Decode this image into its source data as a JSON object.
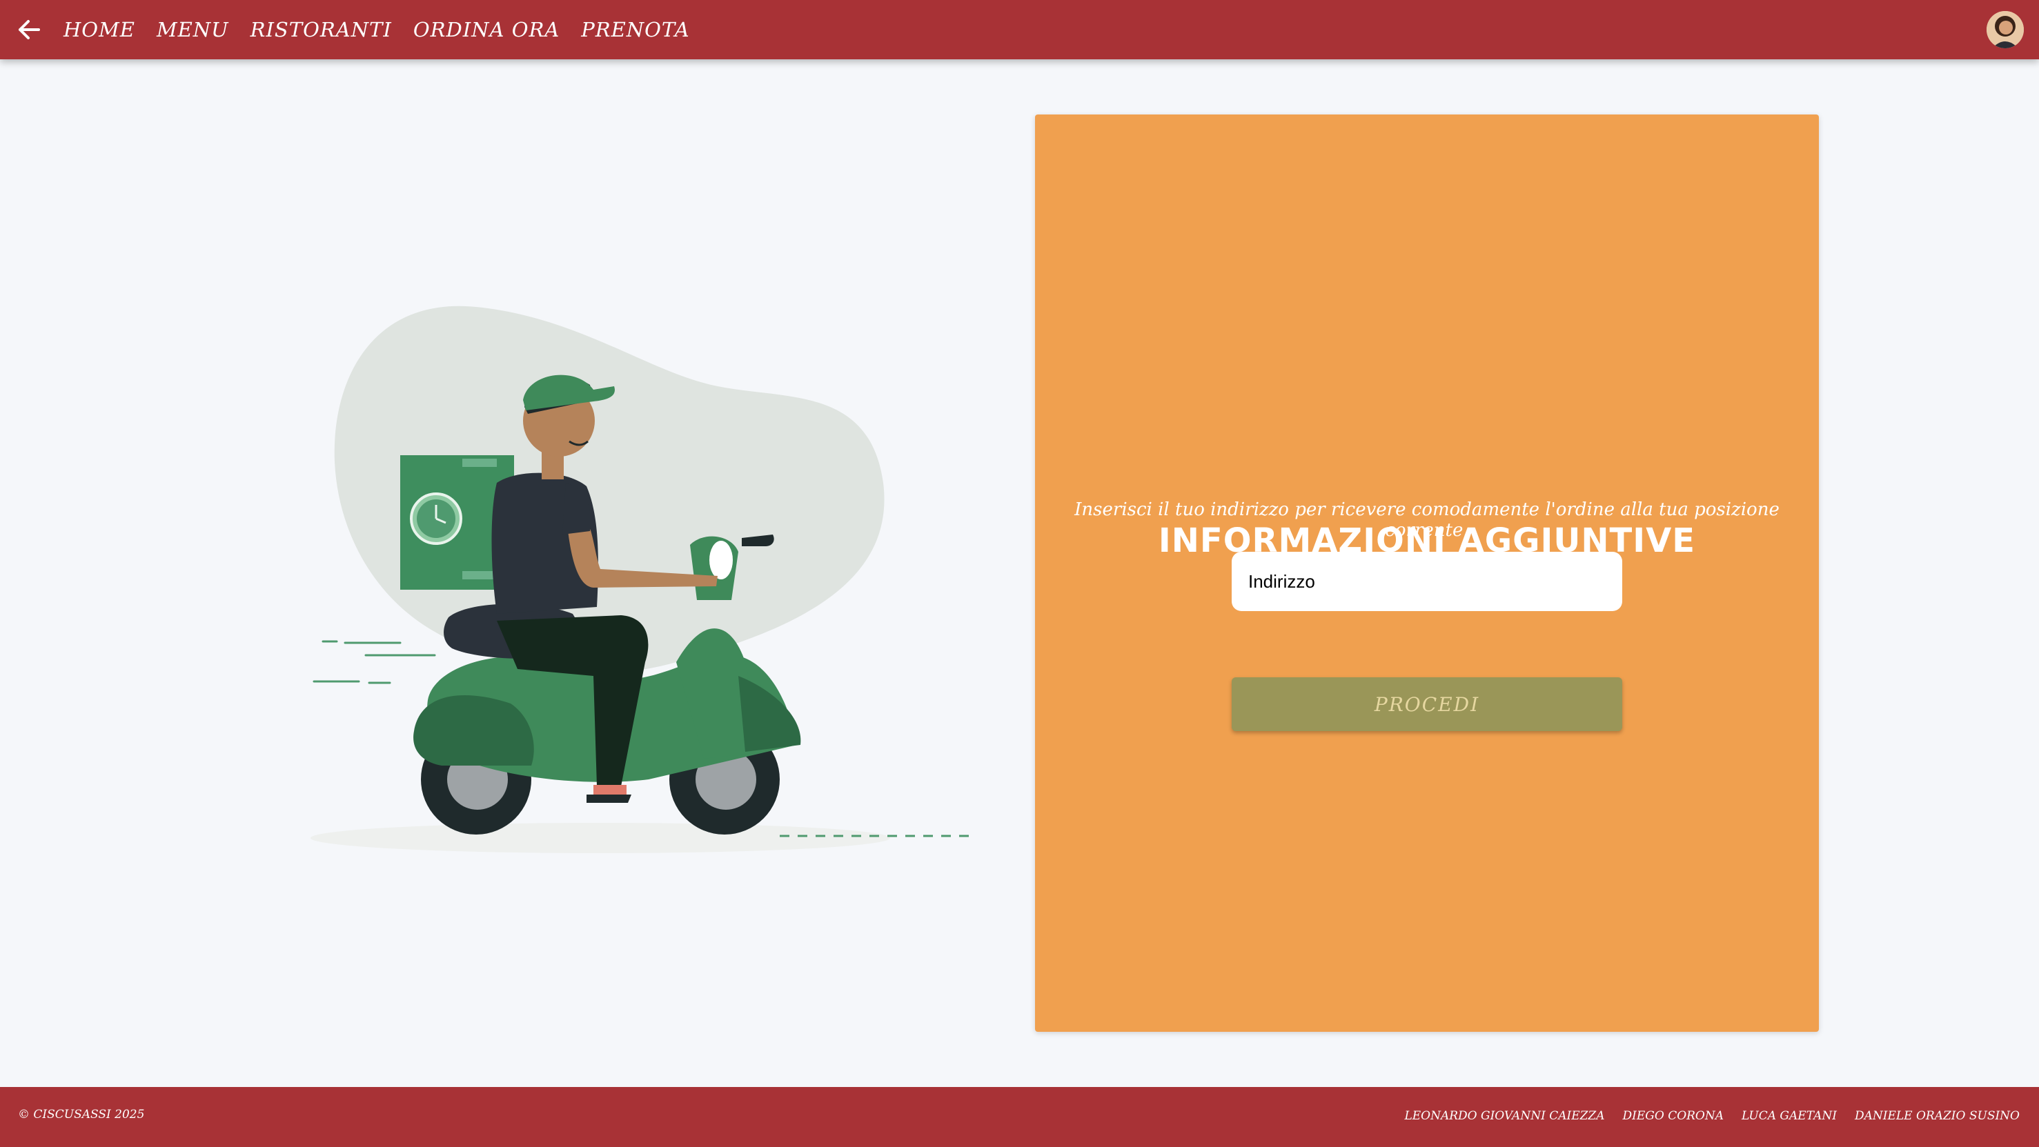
{
  "header": {
    "back_icon": "arrow-left-icon",
    "nav": [
      "HOME",
      "MENU",
      "RISTORANTI",
      "ORDINA ORA",
      "PRENOTA"
    ],
    "avatar_icon": "user-avatar"
  },
  "card": {
    "title": "INFORMAZIONI AGGIUNTIVE",
    "subtitle": "Inserisci il tuo indirizzo per ricevere comodamente l'ordine alla tua posizione corrente.",
    "address_placeholder": "Indirizzo",
    "proceed_label": "PROCEDI"
  },
  "footer": {
    "copyright": "© CISCUSASSI 2025",
    "authors": [
      "LEONARDO GIOVANNI CAIEZZA",
      "DIEGO CORONA",
      "LUCA GAETANI",
      "DANIELE ORAZIO SUSINO"
    ]
  },
  "colors": {
    "header_bg": "#a83236",
    "card_bg": "#f0a04f",
    "button_bg": "#9a9658",
    "page_bg": "#f5f7fa",
    "scooter_green": "#3f8a5a"
  }
}
